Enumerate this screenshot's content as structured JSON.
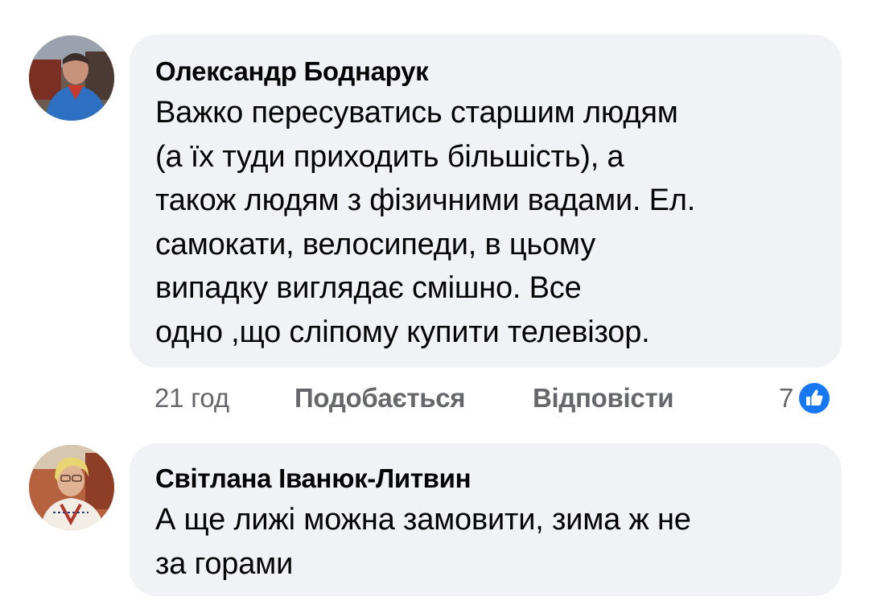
{
  "comments": [
    {
      "author": "Олександр Боднарук",
      "lines": [
        "Важко пересуватись старшим людям",
        "(а їх туди приходить більшість), а",
        "також людям з фізичними вадами. Ел.",
        "самокати, велосипеди, в цьому",
        "випадку виглядає смішно. Все",
        "одно ,що сліпому купити телевізор."
      ],
      "time": "21 год",
      "like_label": "Подобається",
      "reply_label": "Відповісти",
      "reaction_count": "7",
      "reaction_icon": "like-reaction-icon"
    },
    {
      "author": "Світлана Іванюк-Литвин",
      "lines": [
        "А ще лижі можна замовити, зима ж не",
        "за горами"
      ]
    }
  ],
  "colors": {
    "bubble": "#f0f2f5",
    "meta_text": "#65676b",
    "like_blue": "#1877f2",
    "text": "#050505"
  }
}
